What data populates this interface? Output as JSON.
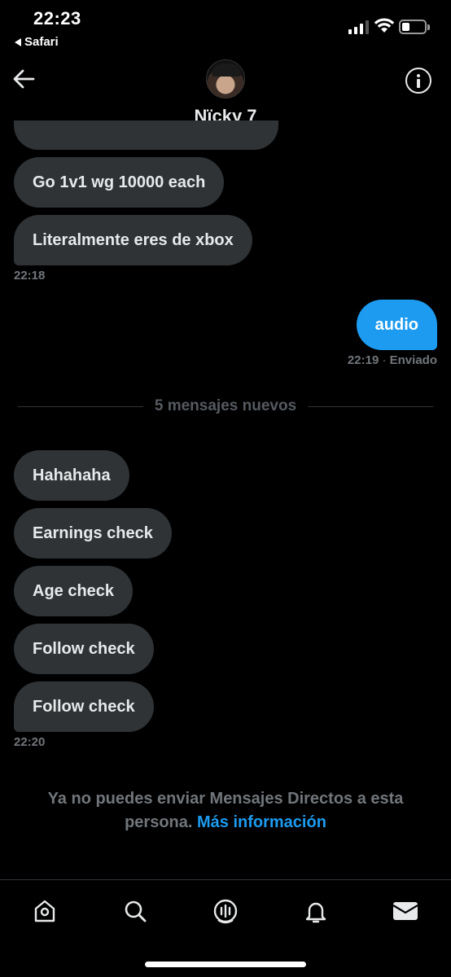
{
  "status_bar": {
    "time": "22:23",
    "back_app": "Safari"
  },
  "header": {
    "contact_name": "Nïcky 7",
    "back_icon": "arrow-left-icon",
    "info_icon": "info-icon"
  },
  "messages": {
    "incoming_group_1": [
      "Go 1v1 wg 10000 each",
      "Literalmente eres de xbox"
    ],
    "incoming_group_1_time": "22:18",
    "outgoing": {
      "text": "audio",
      "time": "22:19",
      "status": "Enviado"
    },
    "new_messages_divider": "5 mensajes nuevos",
    "incoming_group_2": [
      "Hahahaha",
      "Earnings check",
      "Age check",
      "Follow check",
      "Follow check"
    ],
    "incoming_group_2_time": "22:20"
  },
  "notice": {
    "text": "Ya no puedes enviar Mensajes Directos a esta persona.",
    "link": "Más información"
  },
  "tabbar": {
    "items": [
      "home-icon",
      "search-icon",
      "spaces-icon",
      "notifications-icon",
      "messages-icon"
    ]
  },
  "colors": {
    "background": "#000000",
    "incoming_bubble": "#2f3336",
    "outgoing_bubble": "#1d9bf0",
    "muted_text": "#71767b",
    "link": "#1d9bf0"
  }
}
